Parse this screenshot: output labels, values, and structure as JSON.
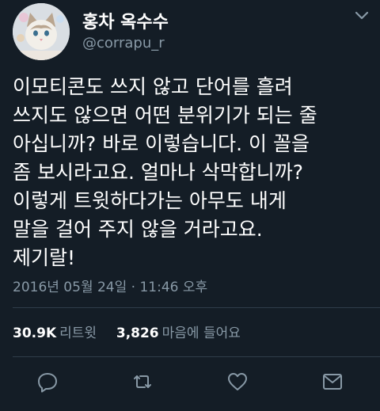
{
  "user": {
    "display_name": "홍차 옥수수",
    "username": "@corrapu_r",
    "avatar_icon": "cat-avatar"
  },
  "tweet": {
    "lines": [
      "이모티콘도 쓰지 않고 단어를 흘려",
      "쓰지도 않으면 어떤 분위기가 되는 줄",
      "아십니까? 바로 이렇습니다. 이 꼴을",
      "좀 보시라고요. 얼마나 삭막합니까?",
      "이렇게 트윗하다가는 아무도 내게",
      "말을 걸어 주지 않을 거라고요.",
      "제기랄!"
    ],
    "timestamp": "2016년 05월 24일 · 11:46 오후"
  },
  "stats": {
    "retweets_count": "30.9K",
    "retweets_label": "리트윗",
    "likes_count": "3,826",
    "likes_label": "마음에 들어요"
  },
  "actions": [
    "reply-icon",
    "retweet-icon",
    "like-icon",
    "message-icon"
  ],
  "colors": {
    "background": "#141d26",
    "text": "#ffffff",
    "secondary": "#8899a6",
    "divider": "#2f3d4a"
  }
}
